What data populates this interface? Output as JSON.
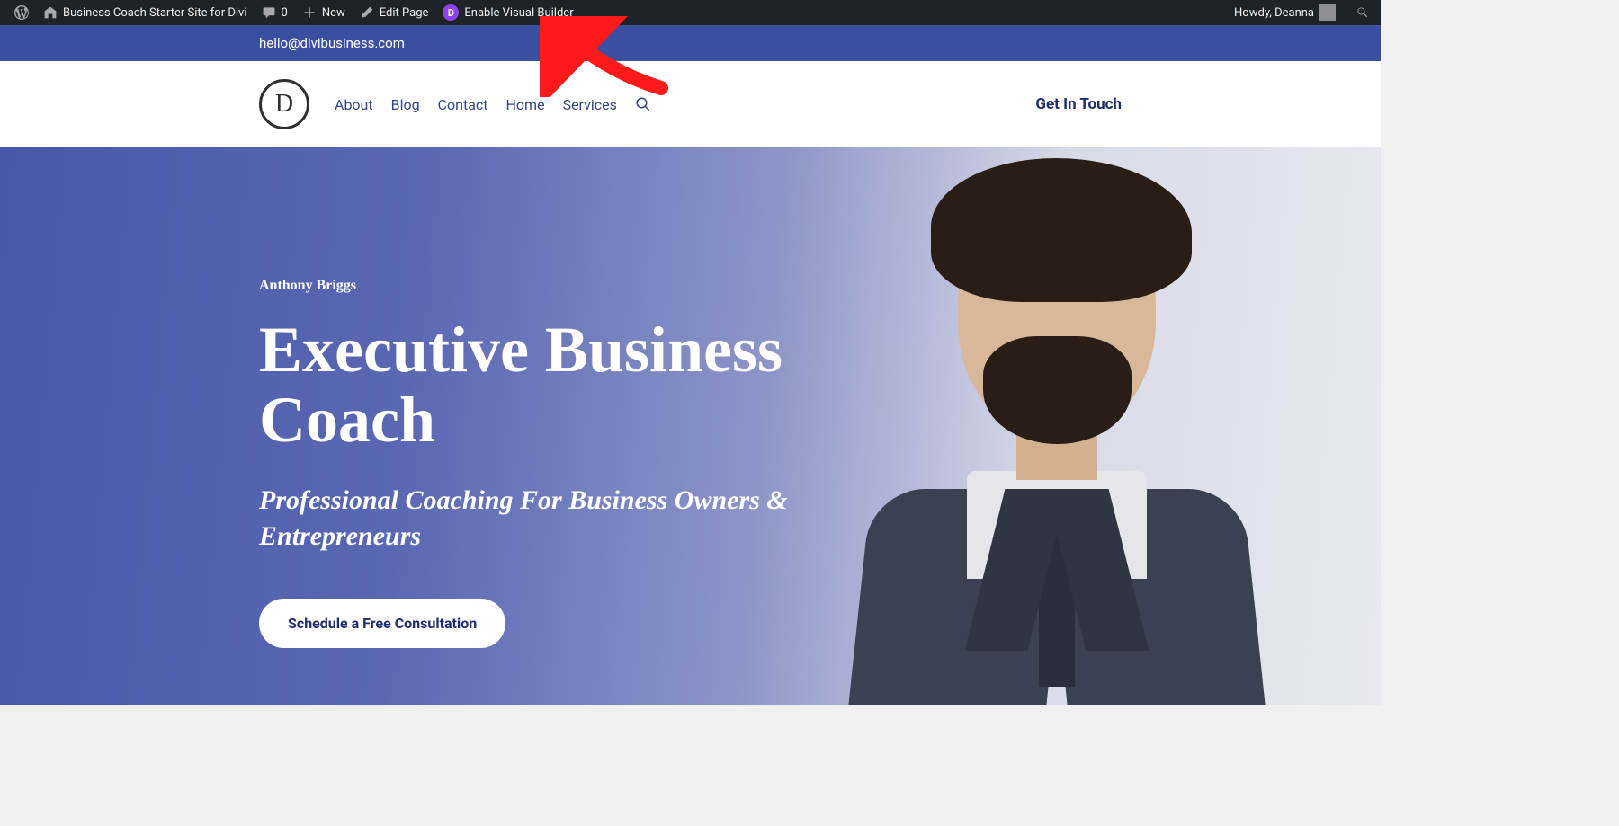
{
  "adminBar": {
    "siteName": "Business Coach Starter Site for Divi",
    "commentsCount": "0",
    "newLabel": "New",
    "editPageLabel": "Edit Page",
    "enableVisualBuilderLabel": "Enable Visual Builder",
    "diviBadge": "D",
    "greeting": "Howdy, Deanna"
  },
  "contactBar": {
    "email": "hello@divibusiness.com"
  },
  "header": {
    "logoLetter": "D",
    "nav": {
      "about": "About",
      "blog": "Blog",
      "contact": "Contact",
      "home": "Home",
      "services": "Services"
    },
    "cta": "Get In Touch"
  },
  "hero": {
    "kicker": "Anthony Briggs",
    "title": "Executive Business Coach",
    "subtitle": "Professional Coaching For Business Owners & Entrepreneurs",
    "cta": "Schedule a Free Consultation"
  }
}
